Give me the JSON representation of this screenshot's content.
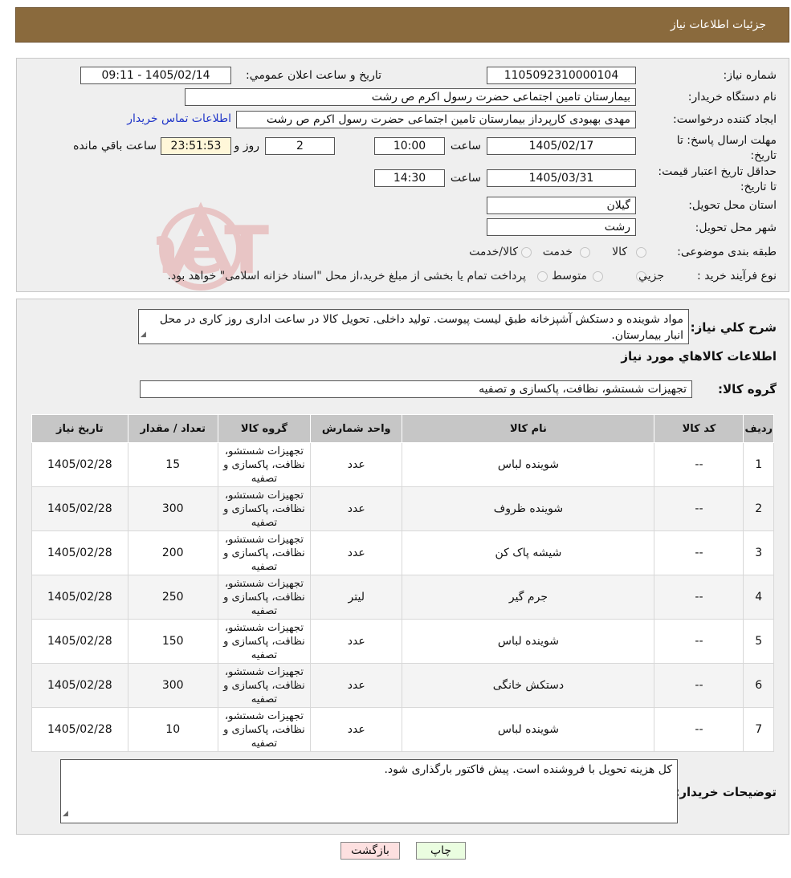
{
  "header": {
    "title": "جزئیات اطلاعات نیاز"
  },
  "form": {
    "need_number_label": "شماره نیاز:",
    "need_number": "1105092310000104",
    "announce_label": "تاریخ و ساعت اعلان عمومي:",
    "announce_value": "1405/02/14 - 09:11",
    "buyer_org_label": "نام دستگاه خريدار:",
    "buyer_org": "بیمارستان  تامین اجتماعی حضرت رسول اکرم ص رشت",
    "creator_label": "ایجاد کننده درخواست:",
    "creator": "مهدی بهبودی کارپرداز بیمارستان  تامین اجتماعی حضرت رسول اکرم ص رشت",
    "contact_link": "اطلاعات تماس خريدار",
    "deadline_label": "مهلت ارسال پاسخ: تا تاريخ:",
    "deadline_date": "1405/02/17",
    "time_label": "ساعت",
    "deadline_time": "10:00",
    "days_value": "2",
    "days_label": "روز و",
    "remaining_time": "23:51:53",
    "remaining_label": "ساعت باقي مانده",
    "validity_label": "حداقل تاريخ اعتبار قيمت: تا تاريخ:",
    "validity_date": "1405/03/31",
    "validity_time": "14:30",
    "province_label": "استان محل تحويل:",
    "province": "گیلان",
    "city_label": "شهر محل تحويل:",
    "city": "رشت",
    "category_label": "طبقه بندی موضوعی:",
    "category_options": [
      "کالا",
      "خدمت",
      "کالا/خدمت"
    ],
    "process_label": "نوع فرآيند خريد :",
    "process_options": [
      "جزیي",
      "متوسط"
    ],
    "payment_note": "پرداخت تمام یا بخشی از مبلغ خرید،از محل \"اسناد خزانه اسلامی\" خواهد بود."
  },
  "summary": {
    "label": "شرح كلي نياز:",
    "text": "مواد شوینده و دستکش آشپزخانه طبق لیست پیوست. تولید داخلی. تحویل کالا در ساعت اداری روز کاری در محل انبار بیمارستان.",
    "items_title": "اطلاعات كالاهاي مورد نياز",
    "group_label": "گروه کالا:",
    "group_value": "تجهیزات شستشو، نظافت، پاکسازی و تصفیه"
  },
  "table": {
    "headers": [
      "رديف",
      "كد كالا",
      "نام كالا",
      "واحد شمارش",
      "گروه كالا",
      "تعداد / مقدار",
      "تاريخ نياز"
    ],
    "rows": [
      {
        "idx": "1",
        "code": "--",
        "name": "شوینده لباس",
        "unit": "عدد",
        "group": "تجهیزات شستشو، نظافت، پاکسازی و تصفیه",
        "qty": "15",
        "date": "1405/02/28"
      },
      {
        "idx": "2",
        "code": "--",
        "name": "شوینده ظروف",
        "unit": "عدد",
        "group": "تجهیزات شستشو، نظافت، پاکسازی و تصفیه",
        "qty": "300",
        "date": "1405/02/28"
      },
      {
        "idx": "3",
        "code": "--",
        "name": "شیشه پاک کن",
        "unit": "عدد",
        "group": "تجهیزات شستشو، نظافت، پاکسازی و تصفیه",
        "qty": "200",
        "date": "1405/02/28"
      },
      {
        "idx": "4",
        "code": "--",
        "name": "جرم گیر",
        "unit": "لیتر",
        "group": "تجهیزات شستشو، نظافت، پاکسازی و تصفیه",
        "qty": "250",
        "date": "1405/02/28"
      },
      {
        "idx": "5",
        "code": "--",
        "name": "شوینده لباس",
        "unit": "عدد",
        "group": "تجهیزات شستشو، نظافت، پاکسازی و تصفیه",
        "qty": "150",
        "date": "1405/02/28"
      },
      {
        "idx": "6",
        "code": "--",
        "name": "دستکش خانگی",
        "unit": "عدد",
        "group": "تجهیزات شستشو، نظافت، پاکسازی و تصفیه",
        "qty": "300",
        "date": "1405/02/28"
      },
      {
        "idx": "7",
        "code": "--",
        "name": "شوینده لباس",
        "unit": "عدد",
        "group": "تجهیزات شستشو، نظافت، پاکسازی و تصفیه",
        "qty": "10",
        "date": "1405/02/28"
      }
    ]
  },
  "buyer_notes": {
    "label": "توضیحات خریدار:",
    "text": "کل هزینه تحویل با فروشنده است. پیش فاکتور بارگذاری شود."
  },
  "buttons": {
    "print": "چاپ",
    "back": "بازگشت"
  },
  "watermark": {
    "text": "AriaTender.neT",
    "icon": "aria-tender-logo-icon"
  },
  "colors": {
    "header": "#8a6a3d",
    "table_header": "#c6c6c6",
    "back_button": "#fde0e0",
    "print_button": "#eafde0",
    "link": "#1f35c8"
  }
}
